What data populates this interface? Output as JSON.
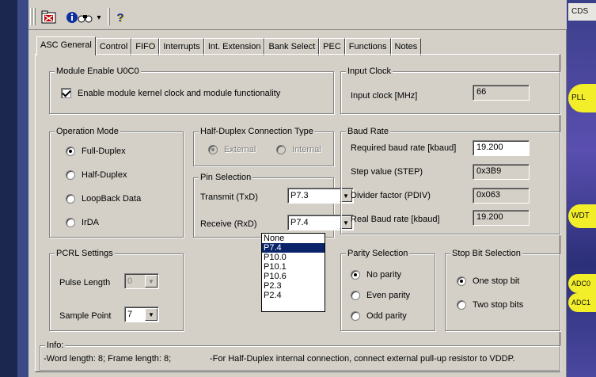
{
  "toolbar": {
    "dropdown_arrow": "▾",
    "help_glyph": "?",
    "icon_a": "folder-red-icon",
    "icon_b": "info-binoculars-icon",
    "icon_c": "help-cursor-icon"
  },
  "tabs": [
    {
      "label": "ASC General",
      "active": true
    },
    {
      "label": "Control"
    },
    {
      "label": "FIFO"
    },
    {
      "label": "Interrupts"
    },
    {
      "label": "Int. Extension"
    },
    {
      "label": "Bank Select"
    },
    {
      "label": "PEC"
    },
    {
      "label": "Functions"
    },
    {
      "label": "Notes"
    }
  ],
  "module_enable": {
    "title": "Module Enable U0C0",
    "checkbox_label": "Enable module kernel clock and module functionality",
    "checked": true
  },
  "input_clock": {
    "title": "Input Clock",
    "label": "Input clock [MHz]",
    "value": "66"
  },
  "operation_mode": {
    "title": "Operation Mode",
    "options": [
      "Full-Duplex",
      "Half-Duplex",
      "LoopBack Data",
      "IrDA"
    ],
    "selected": "Full-Duplex"
  },
  "half_duplex": {
    "title": "Half-Duplex Connection Type",
    "external": "External",
    "internal": "Internal"
  },
  "pin_selection": {
    "title": "Pin Selection",
    "transmit_label": "Transmit (TxD)",
    "transmit_value": "P7.3",
    "receive_label": "Receive (RxD)",
    "receive_value": "P7.4"
  },
  "receive_dropdown": {
    "options": [
      "None",
      "P7.4",
      "P10.0",
      "P10.1",
      "P10.6",
      "P2.3",
      "P2.4"
    ],
    "highlighted": "P7.4"
  },
  "baud_rate": {
    "title": "Baud Rate",
    "required_label": "Required baud rate [kbaud]",
    "required_value": "19.200",
    "step_label": "Step value (STEP)",
    "step_value": "0x3B9",
    "divider_label": "Divider factor (PDIV)",
    "divider_value": "0x063",
    "real_label": "Real Baud rate [kbaud]",
    "real_value": "19.200"
  },
  "pcrl": {
    "title": "PCRL Settings",
    "pulse_label": "Pulse Length",
    "pulse_value": "0",
    "sample_label": "Sample Point",
    "sample_value": "7"
  },
  "parity": {
    "title": "Parity Selection",
    "options": [
      "No parity",
      "Even parity",
      "Odd parity"
    ],
    "selected": "No parity"
  },
  "stop_bit": {
    "title": "Stop Bit Selection",
    "options": [
      "One stop bit",
      "Two stop bits"
    ],
    "selected": "One stop bit"
  },
  "info": {
    "title": "Info:",
    "text1": "-Word length: 8; Frame length: 8;",
    "text2": "-For Half-Duplex internal connection, connect external pull-up resistor to VDDP."
  },
  "side_labels": {
    "cds": "CDS",
    "pll": "PLL",
    "wdt": "WDT",
    "adc0": "ADC0",
    "adc1": "ADC1"
  },
  "colors": {
    "dialog_bg": "#d4d0c8",
    "selection": "#0a246a",
    "side_yellow": "#f2ee2a"
  }
}
